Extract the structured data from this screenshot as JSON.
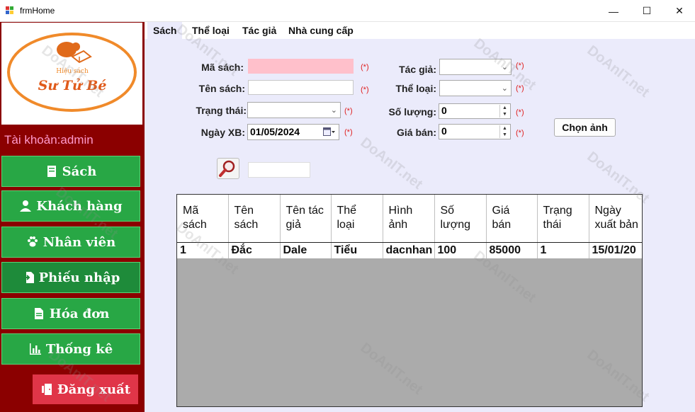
{
  "window": {
    "title": "frmHome",
    "minimize": "—",
    "maximize": "☐",
    "close": "✕"
  },
  "logo": {
    "small_text": "Hiệu sách",
    "big_text": "Sư Tử Bé"
  },
  "sidebar": {
    "account": "Tài khoản:admin",
    "items": [
      {
        "label": "Sách",
        "icon": "book-icon"
      },
      {
        "label": "Khách hàng",
        "icon": "user-icon"
      },
      {
        "label": "Nhân viên",
        "icon": "paw-icon"
      },
      {
        "label": "Phiếu nhập",
        "icon": "file-import-icon"
      },
      {
        "label": "Hóa đơn",
        "icon": "invoice-icon"
      },
      {
        "label": "Thống kê",
        "icon": "chart-icon"
      }
    ],
    "logout": "Đăng xuất"
  },
  "tabs": [
    "Sách",
    "Thể loại",
    "Tác giả",
    "Nhà cung cấp"
  ],
  "form": {
    "ma_sach_label": "Mã sách:",
    "ten_sach_label": "Tên sách:",
    "trang_thai_label": "Trạng thái:",
    "ngay_xb_label": "Ngày XB:",
    "ngay_xb_value": "01/05/2024",
    "tac_gia_label": "Tác giả:",
    "the_loai_label": "Thể loại:",
    "so_luong_label": "Số lượng:",
    "so_luong_value": "0",
    "gia_ban_label": "Giá bán:",
    "gia_ban_value": "0",
    "required": "(*)",
    "chon_anh": "Chọn ảnh"
  },
  "grid": {
    "headers": [
      "Mã sách",
      "Tên sách",
      "Tên tác giả",
      "Thể loại",
      "Hình ảnh",
      "Số lượng",
      "Giá bán",
      "Trạng thái",
      "Ngày xuất bản"
    ],
    "rows": [
      [
        "1",
        "Đắc",
        "Dale",
        "Tiểu",
        "dacnhan",
        "100",
        "85000",
        "1",
        "15/01/20"
      ]
    ]
  },
  "watermark": "DoAnIT.net",
  "colors": {
    "sidebar": "#8b0000",
    "nav_button": "#28a745",
    "logout": "#e03548",
    "main_bg": "#ebebfb",
    "required": "#e02020",
    "account_text": "#ff99cc"
  }
}
